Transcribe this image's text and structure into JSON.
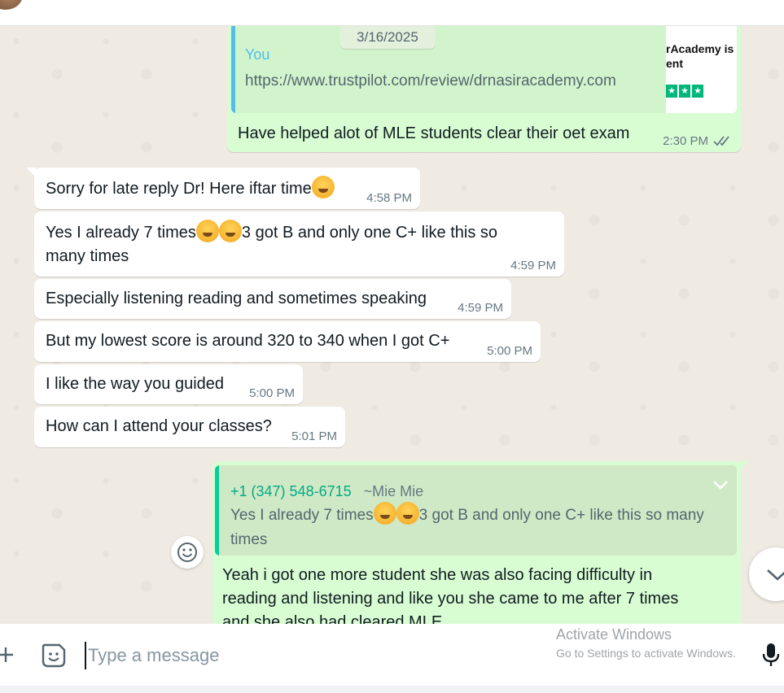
{
  "colors": {
    "incoming_bubble": "#ffffff",
    "outgoing_bubble": "#d9fdd3",
    "quote_bar_you": "#53bdeb",
    "quote_bar_reply": "#06cf9c",
    "reply_phone": "#06a884",
    "read_ticks": "#667781"
  },
  "date_chip": "3/16/2025",
  "link_preview": {
    "author": "You",
    "url": "https://www.trustpilot.com/review/drnasiracademy.com",
    "thumb_text_1": "rAcademy is",
    "thumb_text_2": "ent"
  },
  "messages": [
    {
      "text": "Have helped alot of MLE students clear their oet exam",
      "time": "2:30 PM",
      "icon": "double-check-icon"
    },
    {
      "text": "Sorry for late reply Dr! Here iftar time",
      "time": "4:58 PM",
      "emoji": "smiling-face-icon"
    },
    {
      "text_a": "Yes I already 7 times",
      "text_b": "3 got B and only one C+ like this so",
      "text_c": "many times",
      "time": "4:59 PM",
      "emoji": "weary-face-icon"
    },
    {
      "text": "Especially listening reading and sometimes speaking",
      "time": "4:59 PM"
    },
    {
      "text": "But my lowest score is around 320 to 340 when I got C+",
      "time": "5:00 PM"
    },
    {
      "text": "I like the way you guided",
      "time": "5:00 PM"
    },
    {
      "text": "How can I attend your classes?",
      "time": "5:01 PM"
    }
  ],
  "reply": {
    "phone": "+1 (347) 548-6715",
    "name": "~Mie Mie",
    "quoted_a": "Yes I already 7 times",
    "quoted_b": "3 got B and only one C+ like this so many",
    "quoted_c": "times",
    "line1": "Yeah i got one more student she was also facing difficulty in",
    "line2": "reading and listening and like you she came to me after 7 times",
    "line3": "and she also had cleared MLE"
  },
  "composer": {
    "placeholder": "Type a message",
    "watermark_title": "Activate Windows",
    "watermark_sub": "Go to Settings to activate Windows."
  }
}
